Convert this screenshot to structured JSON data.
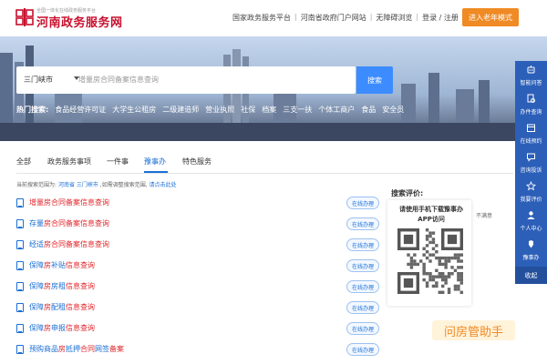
{
  "header": {
    "logo_small": "全国一体化在线政务服务平台",
    "logo_big": "河南政务服务网",
    "links": [
      "国家政务服务平台",
      "河南省政府门户网站",
      "无障碍浏览",
      "登录 / 注册"
    ],
    "senior_mode": "进入老年模式"
  },
  "search": {
    "city": "三门峡市",
    "placeholder": "增量房合同备案信息查询",
    "button": "搜索"
  },
  "hot": {
    "label": "热门搜索:",
    "items": [
      "食品经营许可证",
      "大学生公租房",
      "二级建造师",
      "营业执照",
      "社保",
      "档案",
      "三支一扶",
      "个体工商户",
      "食品",
      "安全员"
    ]
  },
  "tabs": [
    {
      "label": "全部"
    },
    {
      "label": "政务服务事项"
    },
    {
      "label": "一件事"
    },
    {
      "label": "豫事办",
      "active": true
    },
    {
      "label": "特色服务"
    }
  ],
  "scope": {
    "prefix": "当前搜索范围为:",
    "path": "河南省 三门峡市",
    "middle": ",如需调整搜索范围,",
    "link": "请点击此处"
  },
  "online_label": "在线办理",
  "results": [
    {
      "parts": [
        {
          "t": "增量房合同备案信息查询",
          "hl": true
        }
      ]
    },
    {
      "parts": [
        {
          "t": "存量",
          "hl": false
        },
        {
          "t": "房合同备案信息查询",
          "hl": true
        }
      ]
    },
    {
      "parts": [
        {
          "t": "经适",
          "hl": false
        },
        {
          "t": "房合同备案信息查询",
          "hl": true
        }
      ]
    },
    {
      "parts": [
        {
          "t": "保障",
          "hl": false
        },
        {
          "t": "房",
          "hl": true
        },
        {
          "t": "补贴",
          "hl": false
        },
        {
          "t": "信息查询",
          "hl": true
        }
      ]
    },
    {
      "parts": [
        {
          "t": "保障",
          "hl": false
        },
        {
          "t": "房",
          "hl": true
        },
        {
          "t": "房租",
          "hl": false
        },
        {
          "t": "信息查询",
          "hl": true
        }
      ]
    },
    {
      "parts": [
        {
          "t": "保障",
          "hl": false
        },
        {
          "t": "房",
          "hl": true
        },
        {
          "t": "配租",
          "hl": false
        },
        {
          "t": "信息查询",
          "hl": true
        }
      ]
    },
    {
      "parts": [
        {
          "t": "保障",
          "hl": false
        },
        {
          "t": "房",
          "hl": true
        },
        {
          "t": "申报",
          "hl": false
        },
        {
          "t": "信息查询",
          "hl": true
        }
      ]
    },
    {
      "parts": [
        {
          "t": "预购商品",
          "hl": false
        },
        {
          "t": "房",
          "hl": true
        },
        {
          "t": "抵押",
          "hl": false
        },
        {
          "t": "合同",
          "hl": true
        },
        {
          "t": "网签",
          "hl": false
        },
        {
          "t": "备案",
          "hl": true
        }
      ]
    }
  ],
  "evaluation": {
    "label": "搜索评价:",
    "qr_text": "请使用手机下载豫事办APP访问",
    "unsatisfied": "不满意"
  },
  "assistant": "问房管助手",
  "sidebar": {
    "items": [
      {
        "label": "智能问答",
        "icon": "robot-icon"
      },
      {
        "label": "办件查询",
        "icon": "search-doc-icon"
      },
      {
        "label": "在线预约",
        "icon": "calendar-icon"
      },
      {
        "label": "咨询投诉",
        "icon": "chat-icon"
      },
      {
        "label": "我要评价",
        "icon": "star-icon"
      },
      {
        "label": "个人中心",
        "icon": "user-icon"
      },
      {
        "label": "豫事办",
        "icon": "app-icon"
      }
    ],
    "collapse": "收起"
  },
  "colors": {
    "brand_red": "#c8102e",
    "accent_blue": "#1a6fd6",
    "search_blue": "#3c8cff",
    "sidebar_blue": "#2c5fb8",
    "senior_orange": "#f08a24",
    "highlight_red": "#e0262b"
  }
}
